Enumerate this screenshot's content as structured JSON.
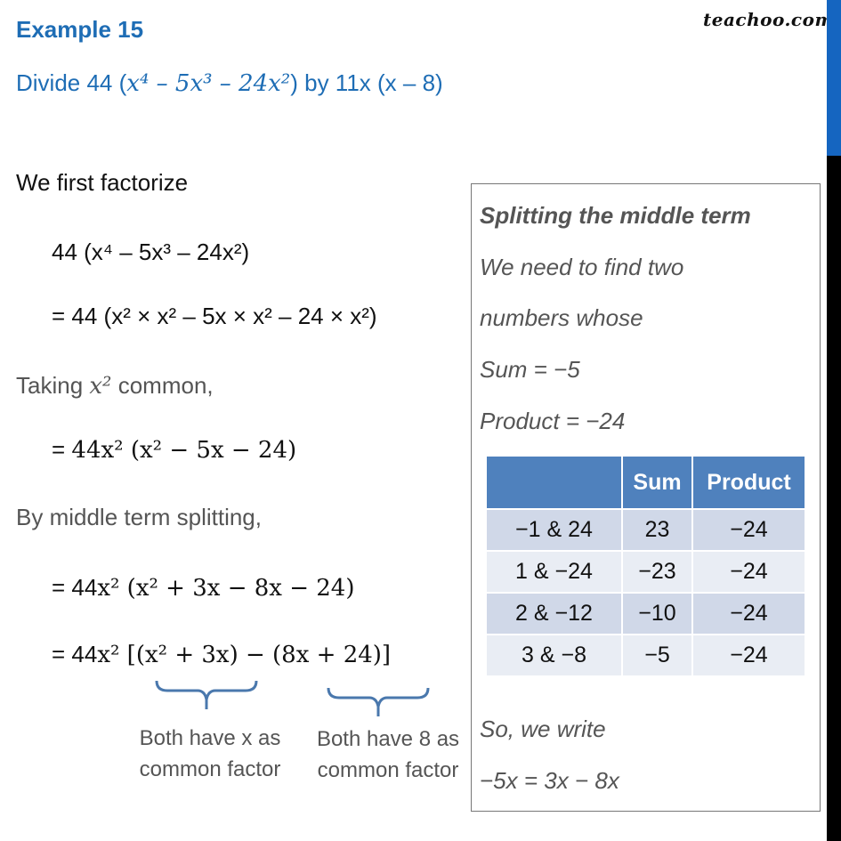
{
  "header": {
    "title": "Example 15",
    "question_prefix": "Divide 44 (",
    "question_math": "x⁴ – 5x³ – 24x²",
    "question_suffix": ") by 11x (x – 8)",
    "logo": "teachoo.com"
  },
  "solution": {
    "intro": "We first factorize",
    "step1": "44 (x⁴ – 5x³ – 24x²)",
    "step2": "= 44 (x² × x² – 5x × x² – 24 × x²)",
    "taking_prefix": "Taking ",
    "taking_math": "x²",
    "taking_suffix": " common,",
    "step3_prefix": "= ",
    "step3": "44x² (x²  −  5x  −  24)",
    "middle_label": "By middle term splitting,",
    "step4_prefix": "= 44",
    "step4": "x² (x² + 3x  −  8x  −  24)",
    "step5_prefix": "= 44",
    "step5": "x² [(x² + 3x)  −  (8x + 24)]",
    "note_left": "Both have x as common factor",
    "note_right": "Both have 8 as common factor"
  },
  "sidebox": {
    "title": "Splitting the middle term",
    "line1": "We need to find two",
    "line2": "numbers whose",
    "sum": "Sum = −5",
    "product": "Product = −24",
    "table": {
      "headers": [
        "",
        "Sum",
        "Product"
      ],
      "rows": [
        [
          "−1 & 24",
          "23",
          "−24"
        ],
        [
          "1 & −24",
          "−23",
          "−24"
        ],
        [
          "2 & −12",
          "−10",
          "−24"
        ],
        [
          "3 & −8",
          "−5",
          "−24"
        ]
      ]
    },
    "conclusion1": "So, we write",
    "conclusion2": "−5x = 3x − 8x"
  },
  "colors": {
    "heading_blue": "#1e6db5",
    "table_header": "#4f81bd",
    "row_dark": "#d0d8e8",
    "row_light": "#e9edf4",
    "brace_blue": "#4a78ad",
    "scroll_thumb": "#1565c0"
  }
}
